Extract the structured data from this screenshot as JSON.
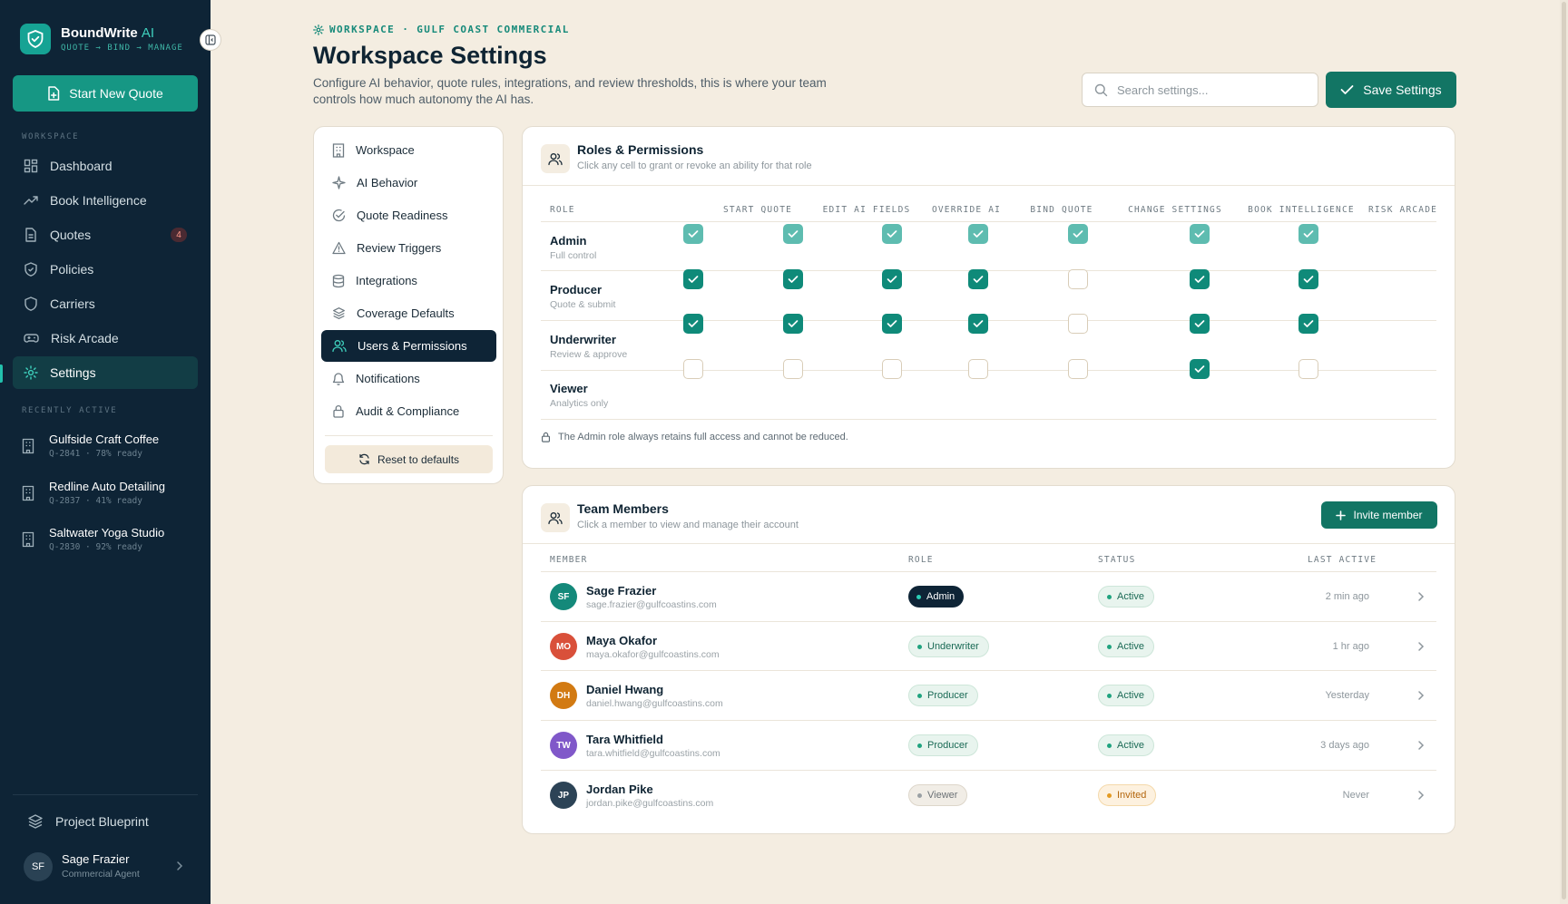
{
  "app": {
    "brand_name": "BoundWrite",
    "brand_ai": "AI",
    "tagline": "QUOTE → BIND → MANAGE",
    "accent": "#169784"
  },
  "sidebar": {
    "new_quote_label": "Start New Quote",
    "workspace_label": "WORKSPACE",
    "items": [
      {
        "label": "Dashboard",
        "icon": "grid-icon"
      },
      {
        "label": "Book Intelligence",
        "icon": "trend-icon"
      },
      {
        "label": "Quotes",
        "icon": "document-icon",
        "badge": "4"
      },
      {
        "label": "Policies",
        "icon": "shield-icon"
      },
      {
        "label": "Carriers",
        "icon": "shield-icon"
      },
      {
        "label": "Risk Arcade",
        "icon": "gamepad-icon"
      },
      {
        "label": "Settings",
        "icon": "gear-icon",
        "active": true
      }
    ],
    "recent_label": "RECENTLY ACTIVE",
    "recent": [
      {
        "name": "Gulfside Craft Coffee",
        "meta": "Q-2841 · 78% ready"
      },
      {
        "name": "Redline Auto Detailing",
        "meta": "Q-2837 · 41% ready"
      },
      {
        "name": "Saltwater Yoga Studio",
        "meta": "Q-2830 · 92% ready"
      }
    ],
    "blueprint_label": "Project Blueprint",
    "user": {
      "initials": "SF",
      "name": "Sage Frazier",
      "role": "Commercial Agent"
    }
  },
  "header": {
    "breadcrumb": "WORKSPACE · GULF COAST COMMERCIAL",
    "title": "Workspace Settings",
    "description": "Configure AI behavior, quote rules, integrations, and review thresholds, this is where your team controls how much autonomy the AI has.",
    "search_placeholder": "Search settings...",
    "save_label": "Save Settings"
  },
  "settings_nav": {
    "items": [
      {
        "label": "Workspace",
        "icon": "building-icon"
      },
      {
        "label": "AI Behavior",
        "icon": "sparkle-icon"
      },
      {
        "label": "Quote Readiness",
        "icon": "check-circle-icon"
      },
      {
        "label": "Review Triggers",
        "icon": "warning-icon"
      },
      {
        "label": "Integrations",
        "icon": "database-icon"
      },
      {
        "label": "Coverage Defaults",
        "icon": "layers-icon"
      },
      {
        "label": "Users & Permissions",
        "icon": "users-icon",
        "active": true
      },
      {
        "label": "Notifications",
        "icon": "bell-icon"
      },
      {
        "label": "Audit & Compliance",
        "icon": "lock-icon"
      }
    ],
    "reset_label": "Reset to defaults"
  },
  "roles": {
    "title": "Roles & Permissions",
    "subtitle": "Click any cell to grant or revoke an ability for that role",
    "role_header": "ROLE",
    "columns": [
      "START QUOTE",
      "EDIT AI FIELDS",
      "OVERRIDE AI",
      "BIND QUOTE",
      "CHANGE SETTINGS",
      "BOOK INTELLIGENCE",
      "RISK ARCADE"
    ],
    "rows": [
      {
        "name": "Admin",
        "desc": "Full control",
        "perms": [
          true,
          true,
          true,
          true,
          true,
          true,
          true
        ],
        "locked": true
      },
      {
        "name": "Producer",
        "desc": "Quote & submit",
        "perms": [
          true,
          true,
          true,
          true,
          false,
          true,
          true
        ],
        "locked": false
      },
      {
        "name": "Underwriter",
        "desc": "Review & approve",
        "perms": [
          true,
          true,
          true,
          true,
          false,
          true,
          true
        ],
        "locked": false
      },
      {
        "name": "Viewer",
        "desc": "Analytics only",
        "perms": [
          false,
          false,
          false,
          false,
          false,
          true,
          false
        ],
        "locked": false
      }
    ],
    "note": "The Admin role always retains full access and cannot be reduced."
  },
  "team": {
    "title": "Team Members",
    "subtitle": "Click a member to view and manage their account",
    "invite_label": "Invite member",
    "headers": {
      "member": "MEMBER",
      "role": "ROLE",
      "status": "STATUS",
      "last": "LAST ACTIVE"
    },
    "members": [
      {
        "initials": "SF",
        "name": "Sage Frazier",
        "email": "sage.frazier@gulfcoastins.com",
        "role": "Admin",
        "status": "Active",
        "last": "2 min ago",
        "color": "#14897a"
      },
      {
        "initials": "MO",
        "name": "Maya Okafor",
        "email": "maya.okafor@gulfcoastins.com",
        "role": "Underwriter",
        "status": "Active",
        "last": "1 hr ago",
        "color": "#d9503a"
      },
      {
        "initials": "DH",
        "name": "Daniel Hwang",
        "email": "daniel.hwang@gulfcoastins.com",
        "role": "Producer",
        "status": "Active",
        "last": "Yesterday",
        "color": "#d27a12"
      },
      {
        "initials": "TW",
        "name": "Tara Whitfield",
        "email": "tara.whitfield@gulfcoastins.com",
        "role": "Producer",
        "status": "Active",
        "last": "3 days ago",
        "color": "#8058c9"
      },
      {
        "initials": "JP",
        "name": "Jordan Pike",
        "email": "jordan.pike@gulfcoastins.com",
        "role": "Viewer",
        "status": "Invited",
        "last": "Never",
        "color": "#2c4356"
      }
    ]
  }
}
